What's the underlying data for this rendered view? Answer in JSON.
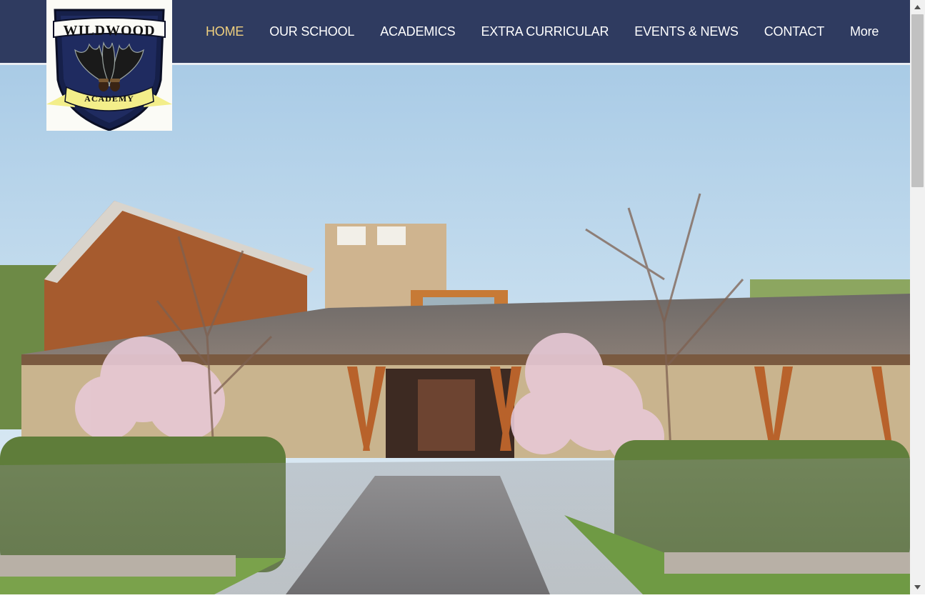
{
  "logo": {
    "top_text": "WILDWOOD",
    "ribbon_text": "ACADEMY"
  },
  "nav": {
    "items": [
      {
        "label": "HOME",
        "active": true
      },
      {
        "label": "OUR SCHOOL",
        "active": false
      },
      {
        "label": "ACADEMICS",
        "active": false
      },
      {
        "label": "EXTRA CURRICULAR",
        "active": false
      },
      {
        "label": "EVENTS & NEWS",
        "active": false
      },
      {
        "label": "CONTACT",
        "active": false
      },
      {
        "label": "More",
        "active": false
      }
    ]
  },
  "colors": {
    "header_bg": "#2f3b60",
    "nav_active": "#efcf7e",
    "nav_text": "#ffffff",
    "shield_navy": "#1c2a55",
    "ribbon_yellow": "#f3ee8a"
  },
  "icons": {
    "scroll_up": "triangle-up-icon",
    "scroll_down": "triangle-down-icon",
    "logo_emblem": "oak-leaves-acorns-icon"
  }
}
